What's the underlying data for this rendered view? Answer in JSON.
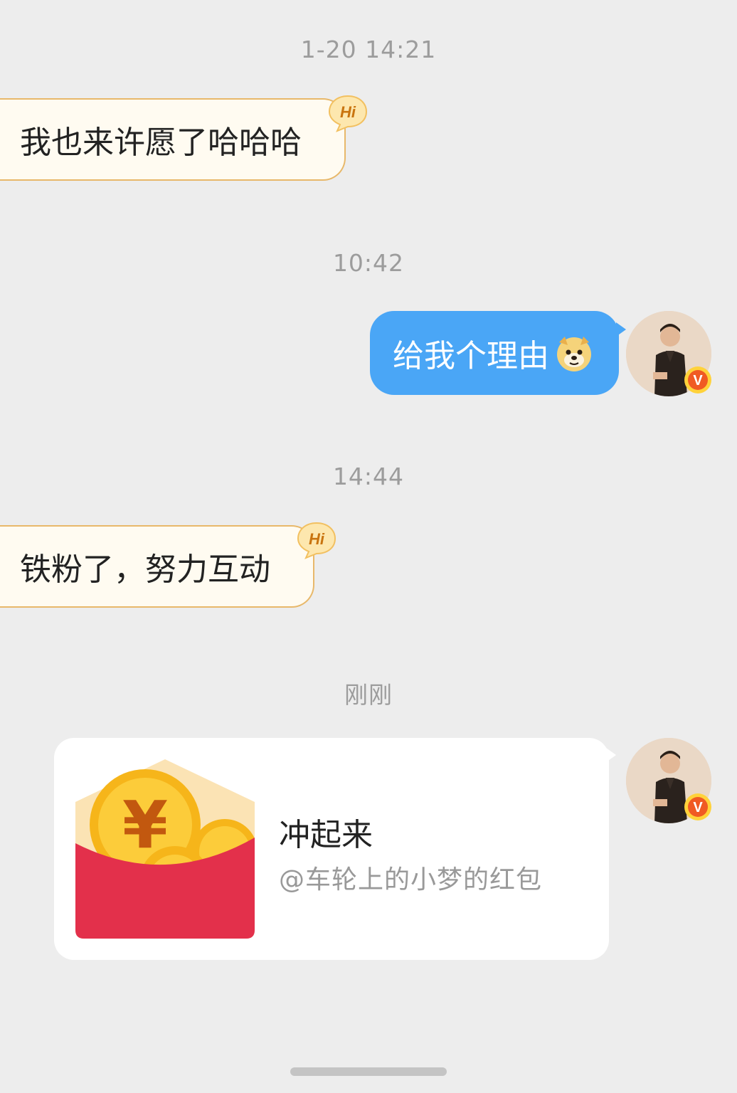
{
  "conversation": {
    "timestamps": [
      "1-20 14:21",
      "10:42",
      "14:44",
      "刚刚"
    ],
    "messages": {
      "incoming_1": "我也来许愿了哈哈哈",
      "outgoing_1": "给我个理由",
      "incoming_2": "铁粉了，努力互动"
    },
    "red_packet": {
      "title": "冲起来",
      "subtitle": "@车轮上的小梦的红包"
    }
  },
  "icons": {
    "hi_badge": "hi-bubble-icon",
    "emoji": "doge-icon",
    "verified": "verified-v-icon",
    "envelope": "red-envelope-icon"
  },
  "badge_text": "Hi",
  "verified_text": "V",
  "colors": {
    "background": "#ededed",
    "incoming_bubble": "#fffbf1",
    "incoming_border": "#e8b86a",
    "outgoing_bubble": "#4aa6f6",
    "card": "#ffffff",
    "envelope_red": "#e3304b",
    "coin_gold": "#f6b51a",
    "verified": "#f05a23"
  }
}
